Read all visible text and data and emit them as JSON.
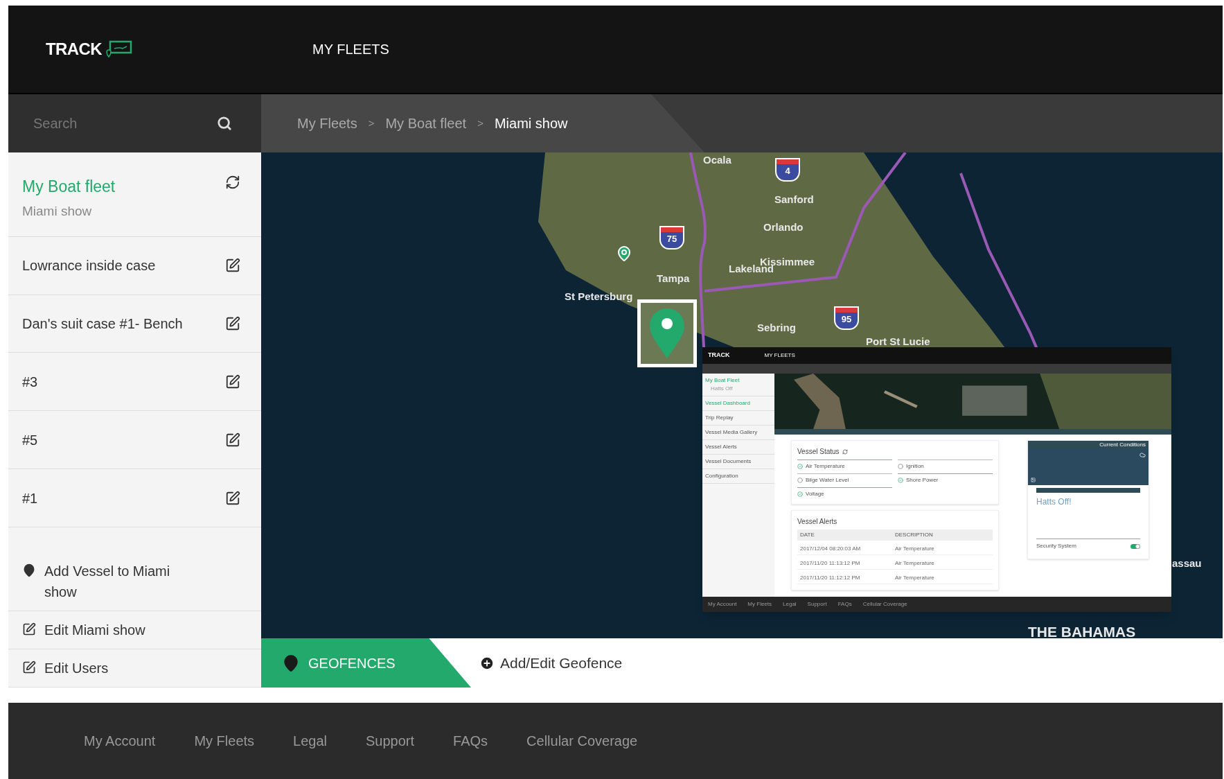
{
  "header": {
    "logo": "TRACK",
    "nav": "MY FLEETS"
  },
  "search": {
    "placeholder": "Search"
  },
  "breadcrumb": [
    {
      "kind": "link",
      "text": "My Fleets"
    },
    {
      "kind": "separator",
      "text": ">"
    },
    {
      "kind": "link",
      "text": "My Boat fleet"
    },
    {
      "kind": "separator",
      "text": ">"
    },
    {
      "kind": "current",
      "text": "Miami show"
    }
  ],
  "sidebar": {
    "fleet": {
      "title": "My Boat fleet",
      "subtitle": "Miami show"
    },
    "vessels": [
      "Lowrance inside case",
      "Dan's suit case #1- Bench",
      "#3",
      "#5",
      "#1"
    ],
    "actions": [
      {
        "kind": "add",
        "label": "Add Vessel to Miami show"
      },
      {
        "kind": "edit",
        "label": "Edit Miami show"
      },
      {
        "kind": "edit",
        "label": "Edit Users"
      }
    ]
  },
  "map": {
    "labels": [
      "Ocala",
      "Sanford",
      "Orlando",
      "Kissimmee",
      "Lakeland",
      "Tampa",
      "St Petersburg",
      "Sebring",
      "Port St Lucie",
      "assau",
      "THE BAHAMAS"
    ],
    "shields": [
      "4",
      "75",
      "95"
    ],
    "inset": {
      "header": {
        "logo": "TRACK",
        "nav": "MY FLEETS"
      },
      "sidebar": {
        "fleet": "My Boat Fleet",
        "vessel": "Hatts Off",
        "items": [
          {
            "label": "Vessel Dashboard",
            "selected": true
          },
          {
            "label": "Trip Replay",
            "selected": false
          },
          {
            "label": "Vessel Media Gallery",
            "selected": false
          },
          {
            "label": "Vessel Alerts",
            "selected": false
          },
          {
            "label": "Vessel Documents",
            "selected": false
          },
          {
            "label": "Configuration",
            "selected": false
          }
        ]
      },
      "status": {
        "title": "Vessel Status",
        "items": [
          {
            "label": "Air Temperature",
            "on": true
          },
          {
            "label": "Ignition",
            "on": false
          },
          {
            "label": "Bilge Water Level",
            "on": false
          },
          {
            "label": "Shore Power",
            "on": true
          },
          {
            "label": "Voltage",
            "on": true
          }
        ]
      },
      "alerts": {
        "title": "Vessel Alerts",
        "columns": [
          "DATE",
          "DESCRIPTION"
        ],
        "rows": [
          [
            "2017/12/04 08:20:03 AM",
            "Air Temperature"
          ],
          [
            "2017/11/20 11:13:12 PM",
            "Air Temperature"
          ],
          [
            "2017/11/20 11:12:12 PM",
            "Air Temperature"
          ]
        ]
      },
      "card": {
        "banner": "Current Conditions",
        "name": "Hatts Off!",
        "security": {
          "label": "Security System",
          "on": true
        }
      },
      "footer": [
        "My Account",
        "My Fleets",
        "Legal",
        "Support",
        "FAQs",
        "Cellular Coverage"
      ]
    }
  },
  "geofences": {
    "tab": "GEOFENCES",
    "action": "Add/Edit Geofence"
  },
  "footer": [
    "My Account",
    "My Fleets",
    "Legal",
    "Support",
    "FAQs",
    "Cellular Coverage"
  ]
}
